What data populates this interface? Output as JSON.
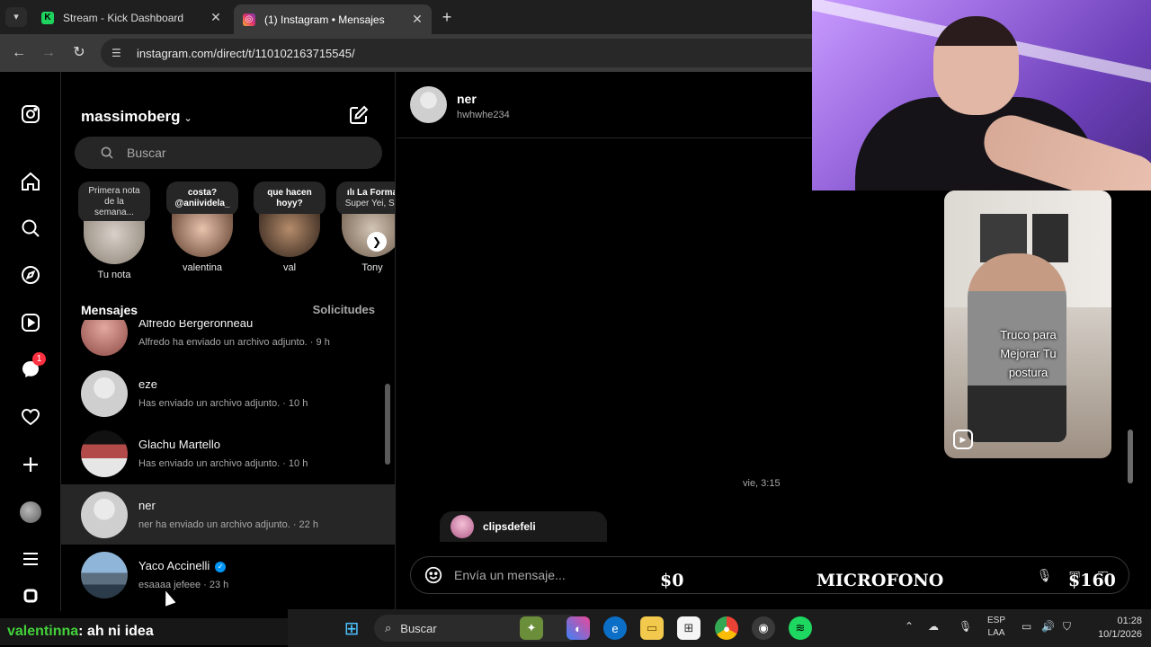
{
  "browser": {
    "tabs": [
      {
        "title": "Stream - Kick Dashboard",
        "favicon": "kick-icon",
        "active": false
      },
      {
        "title": "(1) Instagram • Mensajes",
        "favicon": "instagram-icon",
        "active": true
      }
    ],
    "url": "instagram.com/direct/t/110102163715545/"
  },
  "rail": {
    "notifications_badge": "1"
  },
  "inbox": {
    "account": "massimoberg",
    "search_placeholder": "Buscar",
    "notes": [
      {
        "bubble": "Primera nota de la semana...",
        "label": "Tu nota"
      },
      {
        "bubble_lines": [
          "costa?",
          "@aniividela_"
        ],
        "label": "valentina"
      },
      {
        "bubble_lines": [
          "que hacen",
          "hoyy?"
        ],
        "label": "val"
      },
      {
        "bubble_lines": [
          "ılı La Forma",
          "Super Yei, Sa"
        ],
        "label": "Tony"
      }
    ],
    "section_title": "Mensajes",
    "requests": "Solicitudes",
    "threads": [
      {
        "name": "Alfredo Bergeronneau",
        "preview": "Alfredo ha enviado un archivo adjunto. · 9 h"
      },
      {
        "name": "eze",
        "preview": "Has enviado un archivo adjunto. · 10 h"
      },
      {
        "name": "Glachu Martello",
        "preview": "Has enviado un archivo adjunto. · 10 h"
      },
      {
        "name": "ner",
        "preview": "ner ha enviado un archivo adjunto. · 22 h"
      },
      {
        "name": "Yaco Accinelli",
        "preview": "esaaaa jefeee · 23 h",
        "verified": true
      }
    ]
  },
  "chat": {
    "name": "ner",
    "username": "hwhwhe234",
    "reel_caption": "Truco para Mejorar Tu postura",
    "timestamp": "vie, 3:15",
    "shared_from": "clipsdefeli",
    "composer_placeholder": "Envía un mensaje..."
  },
  "overlay": {
    "left_amount": "$0",
    "center_label": "MICROFONO",
    "right_amount": "$160"
  },
  "stream_chat": {
    "user": "valentinna",
    "message": ": ah ni idea"
  },
  "taskbar": {
    "search": "Buscar",
    "lang_top": "ESP",
    "lang_bottom": "LAA",
    "time": "01:28",
    "date": "10/1/2026"
  }
}
